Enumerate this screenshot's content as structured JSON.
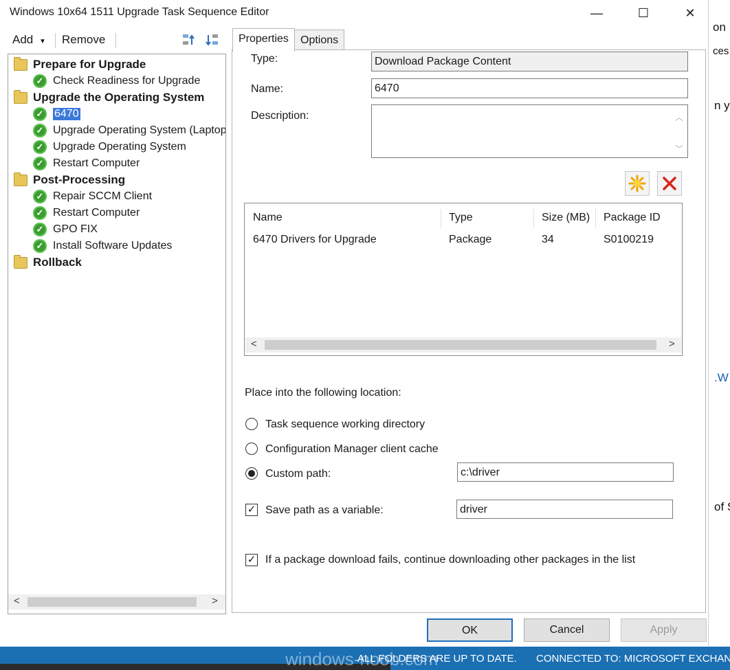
{
  "window": {
    "title": "Windows 10x64 1511 Upgrade Task Sequence Editor",
    "minimize": "—",
    "maximize": "☐",
    "close": "✕"
  },
  "background_window": {
    "fragments": [
      "on",
      "ces",
      "n y",
      ".W",
      "of S"
    ]
  },
  "toolbar": {
    "add_label": "Add",
    "remove_label": "Remove"
  },
  "tree": {
    "groups": [
      {
        "label": "Prepare for Upgrade",
        "steps": [
          "Check Readiness for Upgrade"
        ]
      },
      {
        "label": "Upgrade the Operating System",
        "steps": [
          "6470",
          "Upgrade Operating System (Laptop",
          "Upgrade Operating System",
          "Restart Computer"
        ]
      },
      {
        "label": "Post-Processing",
        "steps": [
          "Repair SCCM Client",
          "Restart Computer",
          "GPO FIX",
          "Install Software Updates"
        ]
      },
      {
        "label": "Rollback",
        "steps": []
      }
    ],
    "selected_step": "6470"
  },
  "tabs": {
    "properties": "Properties",
    "options": "Options"
  },
  "form": {
    "type_label": "Type:",
    "type_value": "Download Package Content",
    "name_label": "Name:",
    "name_value": "6470",
    "description_label": "Description:",
    "description_value": ""
  },
  "package_list": {
    "columns": [
      "Name",
      "Type",
      "Size (MB)",
      "Package ID"
    ],
    "rows": [
      {
        "name": "6470 Drivers for Upgrade",
        "type": "Package",
        "size": "34",
        "package_id": "S0100219"
      }
    ]
  },
  "location": {
    "heading": "Place into the following location:",
    "option_working_dir": "Task sequence working directory",
    "option_client_cache": "Configuration Manager client cache",
    "option_custom_path": "Custom path:",
    "selected": "custom_path",
    "custom_path_value": "c:\\driver",
    "save_variable_label": "Save path as a variable:",
    "save_variable_checked": true,
    "variable_value": "driver",
    "continue_label": "If a package download fails, continue downloading other packages in the list",
    "continue_checked": true
  },
  "buttons": {
    "ok": "OK",
    "cancel": "Cancel",
    "apply": "Apply"
  },
  "status": {
    "folders": "ALL FOLDERS ARE UP TO DATE.",
    "connected": "CONNECTED TO: MICROSOFT EXCHAN"
  },
  "watermark": "windows-noob.com"
}
